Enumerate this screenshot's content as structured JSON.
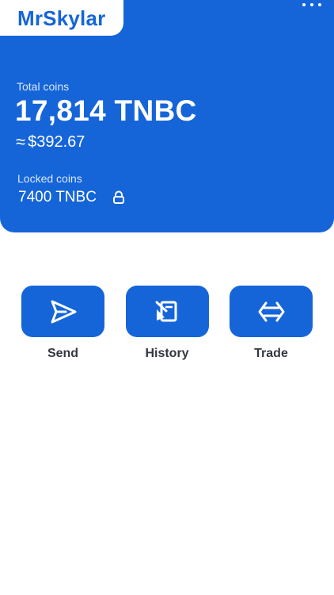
{
  "header": {
    "username": "MrSkylar",
    "more_icon": "more-horizontal-icon"
  },
  "balance": {
    "total_label": "Total coins",
    "total_value": "17,814 TNBC",
    "approx_symbol": "≈",
    "fiat_value": "$392.67",
    "locked_label": "Locked coins",
    "locked_value": "7400 TNBC",
    "lock_icon": "lock-icon"
  },
  "actions": [
    {
      "label": "Send",
      "icon": "send-icon"
    },
    {
      "label": "History",
      "icon": "history-icon"
    },
    {
      "label": "Trade",
      "icon": "trade-icon"
    }
  ],
  "colors": {
    "primary": "#1565d8",
    "background": "#ffffff",
    "label_text": "#333740"
  }
}
